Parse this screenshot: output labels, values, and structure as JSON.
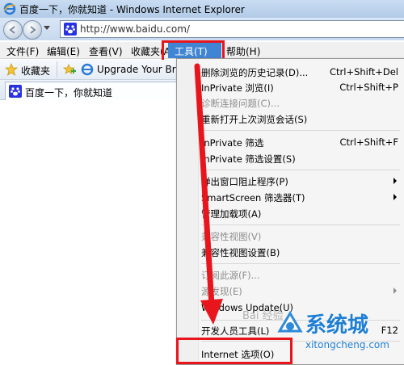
{
  "window": {
    "title": "百度一下，你就知道 - Windows Internet Explorer"
  },
  "address": {
    "url": "http://www.baidu.com/"
  },
  "menubar": {
    "items": [
      "文件(F)",
      "编辑(E)",
      "查看(V)",
      "收藏夹(A)",
      "工具(T)",
      "帮助(H)"
    ],
    "active": "工具(T)"
  },
  "favorites_bar": {
    "favorites_label": "收藏夹",
    "upgrade_label": "Upgrade Your Bro"
  },
  "tab": {
    "title": "百度一下，你就知道"
  },
  "tools_menu": {
    "items": [
      {
        "label": "删除浏览的历史记录(D)...",
        "shortcut": "Ctrl+Shift+Del",
        "enabled": true
      },
      {
        "label": "InPrivate 浏览(I)",
        "shortcut": "Ctrl+Shift+P",
        "enabled": true
      },
      {
        "label": "诊断连接问题(C)...",
        "shortcut": "",
        "enabled": false
      },
      {
        "label": "重新打开上次浏览会话(S)",
        "shortcut": "",
        "enabled": true
      },
      {
        "label": "InPrivate 筛选",
        "shortcut": "Ctrl+Shift+F",
        "enabled": true
      },
      {
        "label": "InPrivate 筛选设置(S)",
        "shortcut": "",
        "enabled": true
      },
      {
        "label": "弹出窗口阻止程序(P)",
        "shortcut": "",
        "enabled": true,
        "submenu": true
      },
      {
        "label": "SmartScreen 筛选器(T)",
        "shortcut": "",
        "enabled": true,
        "submenu": true
      },
      {
        "label": "管理加载项(A)",
        "shortcut": "",
        "enabled": true
      },
      {
        "label": "兼容性视图(V)",
        "shortcut": "",
        "enabled": false
      },
      {
        "label": "兼容性视图设置(B)",
        "shortcut": "",
        "enabled": true
      },
      {
        "label": "订阅此源(F)...",
        "shortcut": "",
        "enabled": false
      },
      {
        "label": "源发现(E)",
        "shortcut": "",
        "enabled": false,
        "submenu": true
      },
      {
        "label": "Windows Update(U)",
        "shortcut": "",
        "enabled": true
      },
      {
        "label": "开发人员工具(L)",
        "shortcut": "F12",
        "enabled": true
      },
      {
        "label": "Internet 选项(O)",
        "shortcut": "",
        "enabled": true
      }
    ]
  },
  "watermark": {
    "brand": "系统城",
    "site": "xitongcheng.com",
    "overlay": "Bai 经验"
  },
  "colors": {
    "highlight": "#e8161c",
    "menu_active": "#3f85d3"
  }
}
